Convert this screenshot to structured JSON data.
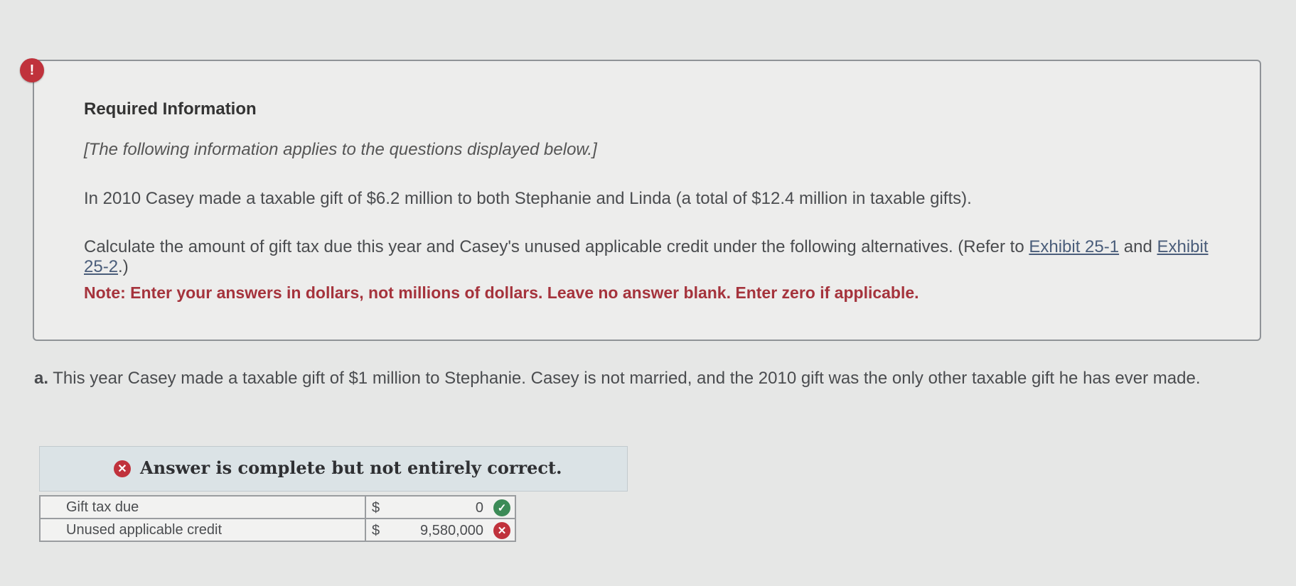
{
  "info": {
    "alert_symbol": "!",
    "title": "Required Information",
    "italic_intro": "[The following information applies to the questions displayed below.]",
    "paragraph1": "In 2010 Casey made a taxable gift of $6.2 million to both Stephanie and Linda (a total of $12.4 million in taxable gifts).",
    "paragraph2_start": "Calculate the amount of gift tax due this year and Casey's unused applicable credit under the following alternatives. (Refer to ",
    "exhibit1_link": "Exhibit 25-1",
    "paragraph2_mid": " and ",
    "exhibit2_link": "Exhibit 25-2",
    "paragraph2_end": ".)",
    "note": "Note: Enter your answers in dollars, not millions of dollars. Leave no answer blank. Enter zero if applicable."
  },
  "question": {
    "label": "a.",
    "text": " This year Casey made a taxable gift of $1 million to Stephanie. Casey is not married, and the 2010 gift was the only other taxable gift he has ever made."
  },
  "result": {
    "status_text": "Answer is complete but not entirely correct.",
    "rows": [
      {
        "label": "Gift tax due",
        "currency": "$",
        "value": "0",
        "status": "correct"
      },
      {
        "label": "Unused applicable credit",
        "currency": "$",
        "value": "9,580,000",
        "status": "incorrect"
      }
    ]
  },
  "colors": {
    "alert": "#c0323c",
    "note": "#a5333c",
    "correct": "#3c8b57",
    "incorrect": "#c0323c"
  }
}
